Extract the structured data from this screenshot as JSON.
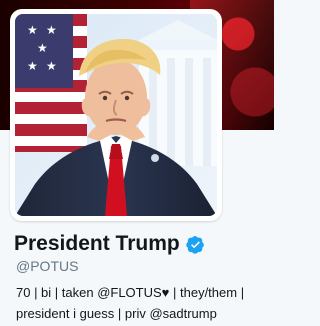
{
  "profile": {
    "name": "President Trump",
    "handle": "@POTUS",
    "verified": true
  },
  "bio": {
    "line1": "70 | bi | taken @FLOTUS♥ | they/them |",
    "line2": "president i guess | priv @sadtrump"
  },
  "icons": {
    "verified": "verified-badge-icon"
  },
  "colors": {
    "background": "#f5f8fa",
    "name": "#14171a",
    "handle": "#657786",
    "verified": "#1da1f2"
  }
}
